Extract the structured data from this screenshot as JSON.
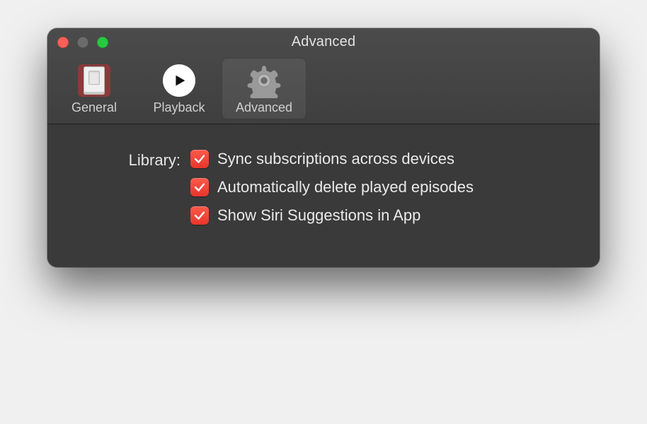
{
  "window": {
    "title": "Advanced"
  },
  "tabs": {
    "general": "General",
    "playback": "Playback",
    "advanced": "Advanced"
  },
  "section": {
    "library_label": "Library:"
  },
  "options": {
    "sync": {
      "label": "Sync subscriptions across devices",
      "checked": true
    },
    "autodelete": {
      "label": "Automatically delete played episodes",
      "checked": true
    },
    "siri": {
      "label": "Show Siri Suggestions in App",
      "checked": true
    }
  }
}
